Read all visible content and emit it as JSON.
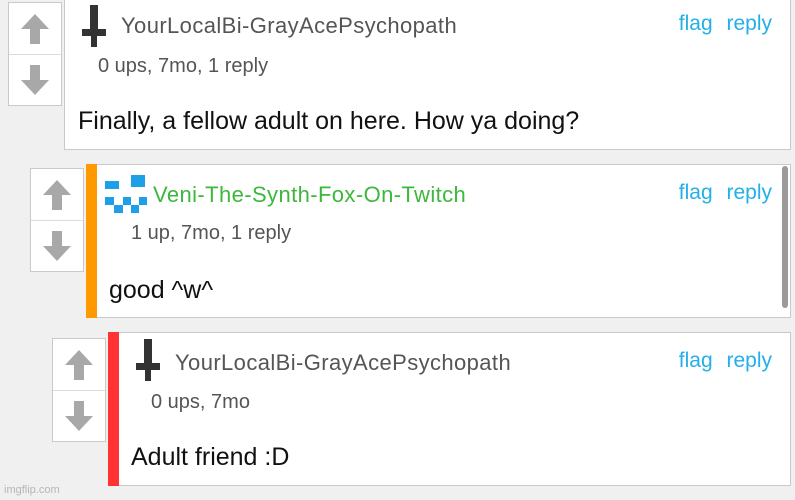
{
  "comments": [
    {
      "username": "YourLocalBi-GrayAcePsychopath",
      "username_color": "#555555",
      "meta": "0 ups, 7mo, 1 reply",
      "text": "Finally, a fellow adult on here. How ya doing?",
      "flag": "flag",
      "reply": "reply",
      "avatar": "dagger-icon"
    },
    {
      "username": "Veni-The-Synth-Fox-On-Twitch",
      "username_color": "#3cb83c",
      "meta": "1 up, 7mo, 1 reply",
      "text": "good ^w^",
      "flag": "flag",
      "reply": "reply",
      "avatar": "pixel-face-icon",
      "bar_color": "#ff9900"
    },
    {
      "username": "YourLocalBi-GrayAcePsychopath",
      "username_color": "#555555",
      "meta": "0 ups, 7mo",
      "text": "Adult friend :D",
      "flag": "flag",
      "reply": "reply",
      "avatar": "dagger-icon",
      "bar_color": "#ff3333"
    }
  ],
  "watermark": "imgflip.com",
  "colors": {
    "link": "#22b0e8",
    "arrow": "#a8a8a8"
  }
}
